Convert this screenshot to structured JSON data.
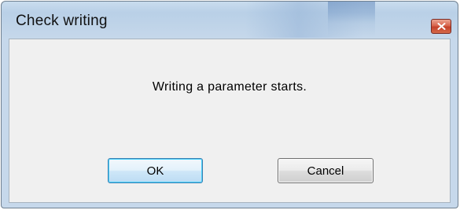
{
  "dialog": {
    "title": "Check writing",
    "message": "Writing a parameter starts.",
    "buttons": {
      "ok_label": "OK",
      "cancel_label": "Cancel"
    },
    "close_icon": "close-icon"
  },
  "colors": {
    "titlebar": "#bed3e8",
    "client_background": "#f0f0f0",
    "close_button": "#c4412a",
    "default_button_border": "#3c7fb1"
  }
}
